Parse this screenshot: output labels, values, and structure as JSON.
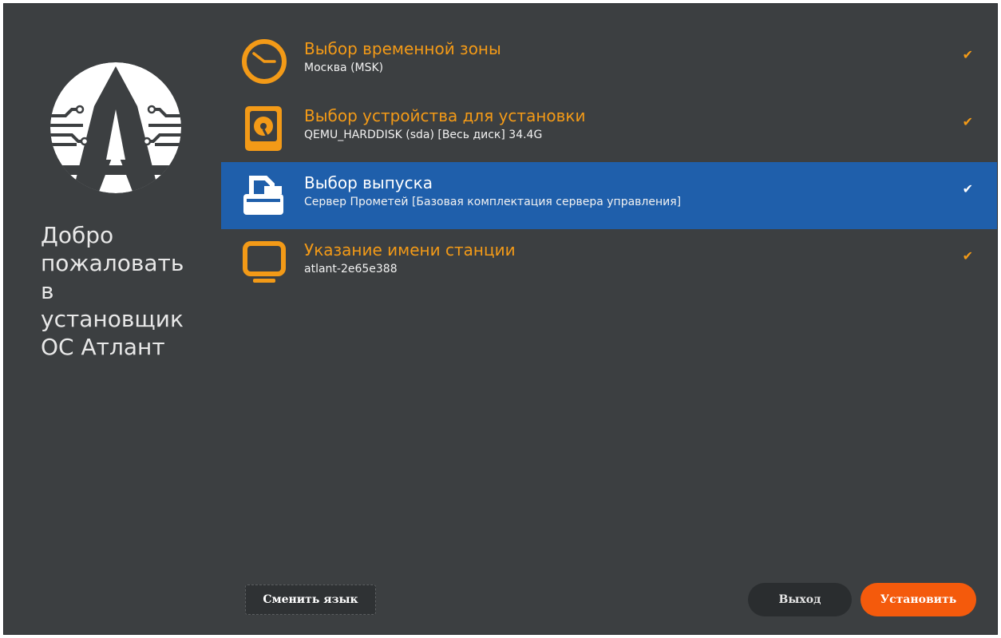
{
  "sidebar": {
    "welcome_lines": [
      "Добро",
      "пожаловать",
      "в",
      "установщик",
      "ОС Атлант"
    ]
  },
  "steps": [
    {
      "title": "Выбор временной зоны",
      "subtitle": "Москва (MSK)",
      "icon": "clock-icon",
      "check": "✔",
      "selected": false
    },
    {
      "title": "Выбор устройства для установки",
      "subtitle": "QEMU_HARDDISK (sda) [Весь диск] 34.4G",
      "icon": "harddisk-icon",
      "check": "✔",
      "selected": false
    },
    {
      "title": "Выбор выпуска",
      "subtitle": "Сервер Прометей  [Базовая комплектация сервера управления]",
      "icon": "package-icon",
      "check": "✔",
      "selected": true
    },
    {
      "title": "Указание имени станции",
      "subtitle": "atlant-2e65e388",
      "icon": "monitor-icon",
      "check": "✔",
      "selected": false
    }
  ],
  "buttons": {
    "change_language": "Сменить язык",
    "exit": "Выход",
    "install": "Установить"
  },
  "colors": {
    "background": "#3c3f41",
    "accent": "#f39a17",
    "selected": "#1f5fab",
    "install": "#f45a0c"
  }
}
